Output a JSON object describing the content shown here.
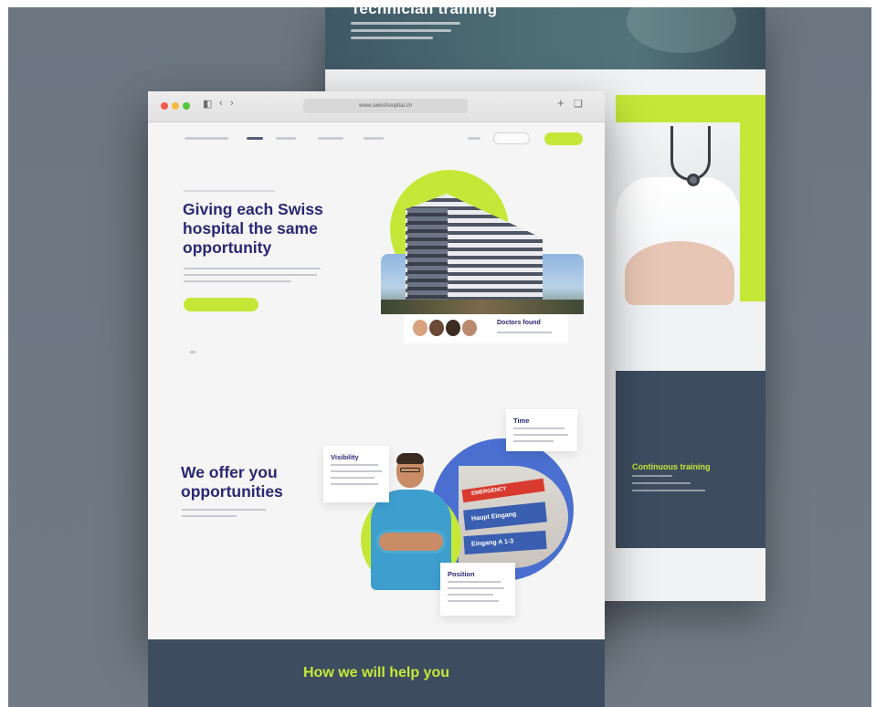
{
  "back_page": {
    "hero_title": "Technician training",
    "dark_title": "Continuous training"
  },
  "browser": {
    "url": "www.swisshospital.ch"
  },
  "hero": {
    "title": "Giving each Swiss hospital the same opportunity"
  },
  "doctors_card": {
    "label": "Doctors found"
  },
  "offer": {
    "title": "We offer you opportunities",
    "cards": {
      "time": "Time",
      "visibility": "Visibility",
      "position": "Position"
    },
    "sign_emergency": "EMERGENCY",
    "sign_line1": "Haupt Eingang",
    "sign_line2": "Eingang A 1-3"
  },
  "help": {
    "title": "How we will help you"
  },
  "colors": {
    "accent_lime": "#c5e838",
    "brand_navy": "#2b2774",
    "dark_slate": "#3e4c60"
  },
  "icons": [
    "sidebar-icon",
    "back-icon",
    "forward-icon",
    "share-icon",
    "add-tab-icon",
    "tabs-icon"
  ]
}
